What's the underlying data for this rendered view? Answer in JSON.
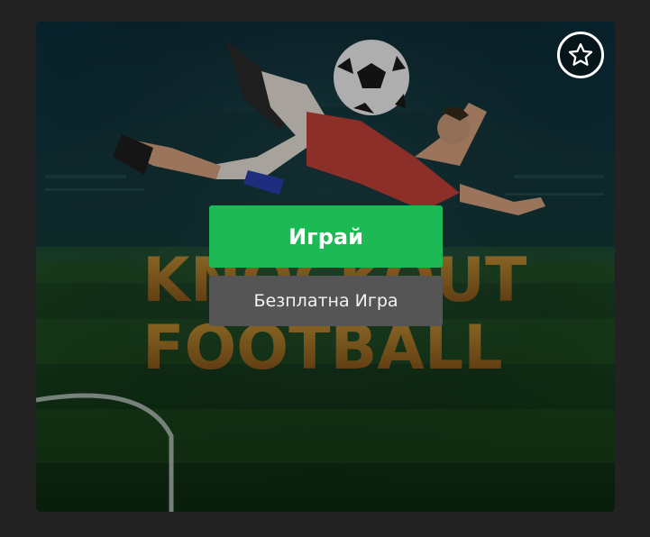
{
  "game": {
    "title_art": "KNOCKOUT FOOTBALL",
    "play_label": "Играй",
    "demo_label": "Безплатна Игра",
    "favorite_icon": "star-outline-icon"
  },
  "colors": {
    "page_background": "#222222",
    "play_button": "#1db954",
    "demo_button": "#555555",
    "text": "#ffffff"
  }
}
